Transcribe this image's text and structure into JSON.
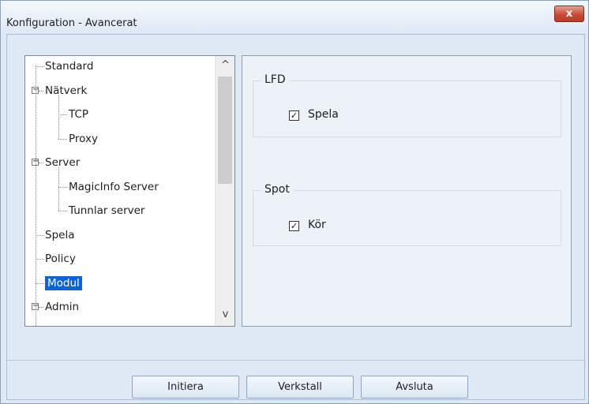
{
  "window": {
    "title": "Konfiguration - Avancerat",
    "close_glyph": "x"
  },
  "tree": {
    "items": [
      {
        "label": "Standard",
        "level": 0,
        "expander": false
      },
      {
        "label": "Nätverk",
        "level": 0,
        "expander": true
      },
      {
        "label": "TCP",
        "level": 1,
        "expander": false
      },
      {
        "label": "Proxy",
        "level": 1,
        "expander": false
      },
      {
        "label": "Server",
        "level": 0,
        "expander": true
      },
      {
        "label": "MagicInfo Server",
        "level": 1,
        "expander": false
      },
      {
        "label": "Tunnlar server",
        "level": 1,
        "expander": false
      },
      {
        "label": "Spela",
        "level": 0,
        "expander": false
      },
      {
        "label": "Policy",
        "level": 0,
        "expander": false
      },
      {
        "label": "Modul",
        "level": 0,
        "expander": false,
        "selected": true
      },
      {
        "label": "Admin",
        "level": 0,
        "expander": true
      }
    ],
    "expander_glyph": "−",
    "scroll_up_glyph": "^",
    "scroll_down_glyph": "v"
  },
  "groups": [
    {
      "title": "LFD",
      "checkbox_label": "Spela",
      "checked": true
    },
    {
      "title": "Spot",
      "checkbox_label": "Kör",
      "checked": true
    }
  ],
  "check_glyph": "✓",
  "buttons": {
    "initiera": "Initiera",
    "verkstall": "Verkstall",
    "avsluta": "Avsluta"
  },
  "colors": {
    "selection": "#0a64d6",
    "close_button": "#c94a37"
  }
}
